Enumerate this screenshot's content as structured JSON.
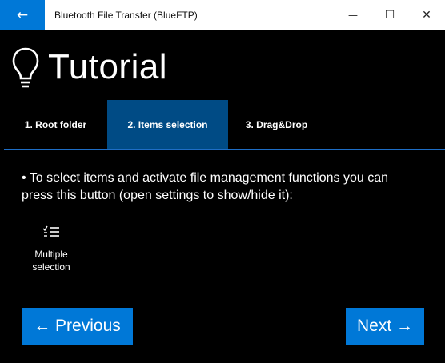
{
  "window": {
    "back_glyph": "←",
    "title": "Bluetooth File Transfer (BlueFTP)",
    "minimize_glyph": "—",
    "maximize_glyph": "☐",
    "close_glyph": "✕"
  },
  "header": {
    "icon": "lightbulb-icon",
    "title": "Tutorial"
  },
  "tabs": [
    {
      "label": "1. Root folder",
      "selected": false
    },
    {
      "label": "2. Items selection",
      "selected": true
    },
    {
      "label": "3. Drag&Drop",
      "selected": false
    }
  ],
  "content": {
    "description": "• To select items and activate file management functions you can press this button (open settings to show/hide it):",
    "multi_selection": {
      "icon": "multiple-selection-icon",
      "label_line1": "Multiple",
      "label_line2": "selection"
    }
  },
  "nav": {
    "previous_label": "← Previous",
    "next_label": "Next →"
  },
  "colors": {
    "accent": "#0078d7",
    "selected_tab": "#004b85",
    "tab_underline": "#1e6ec6",
    "background": "#000000"
  }
}
